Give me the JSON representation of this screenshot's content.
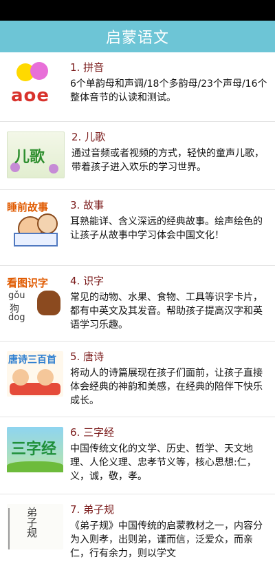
{
  "header": {
    "title": "启蒙语文"
  },
  "items": [
    {
      "title": "1. 拼音",
      "desc": "6个单韵母和声调/18个多韵母/23个声母/16个整体音节的认读和测试。",
      "thumb_text": "aoe"
    },
    {
      "title": "2. 儿歌",
      "desc": "通过音频或者视频的方式，轻快的童声儿歌，带着孩子进入欢乐的学习世界。",
      "thumb_text": "儿歌"
    },
    {
      "title": "3. 故事",
      "desc": "耳熟能详、含义深远的经典故事。绘声绘色的让孩子从故事中学习体会中国文化！",
      "thumb_text": "睡前故事"
    },
    {
      "title": "4. 识字",
      "desc": "常见的动物、水果、食物、工具等识字卡片，都有中英文及其发音。帮助孩子提高汉字和英语学习乐趣。",
      "thumb_text": "看图识字",
      "thumb_pinyin": "gǒu",
      "thumb_hanzi": "狗",
      "thumb_en": "dog"
    },
    {
      "title": "5. 唐诗",
      "desc": "将动人的诗篇展现在孩子们面前，让孩子直接体会经典的神韵和美感，在经典的陪伴下快乐成长。",
      "thumb_text": "唐诗三百首"
    },
    {
      "title": "6. 三字经",
      "desc": "中国传统文化的文学、历史、哲学、天文地理、人伦义理、忠孝节义等，核心思想:仁，义，诚，敬，孝。",
      "thumb_text": "三字经"
    },
    {
      "title": "7. 弟子规",
      "desc": "《弟子规》中国传统的启蒙教材之一，内容分为入则孝，出则弟，谨而信，泛爱众，而亲仁，行有余力，则以学文",
      "thumb_text": "弟子规"
    }
  ],
  "colors": {
    "header_bg": "#6dc5d6",
    "title_text": "#7a1a1a",
    "status_bar": "#000000"
  }
}
